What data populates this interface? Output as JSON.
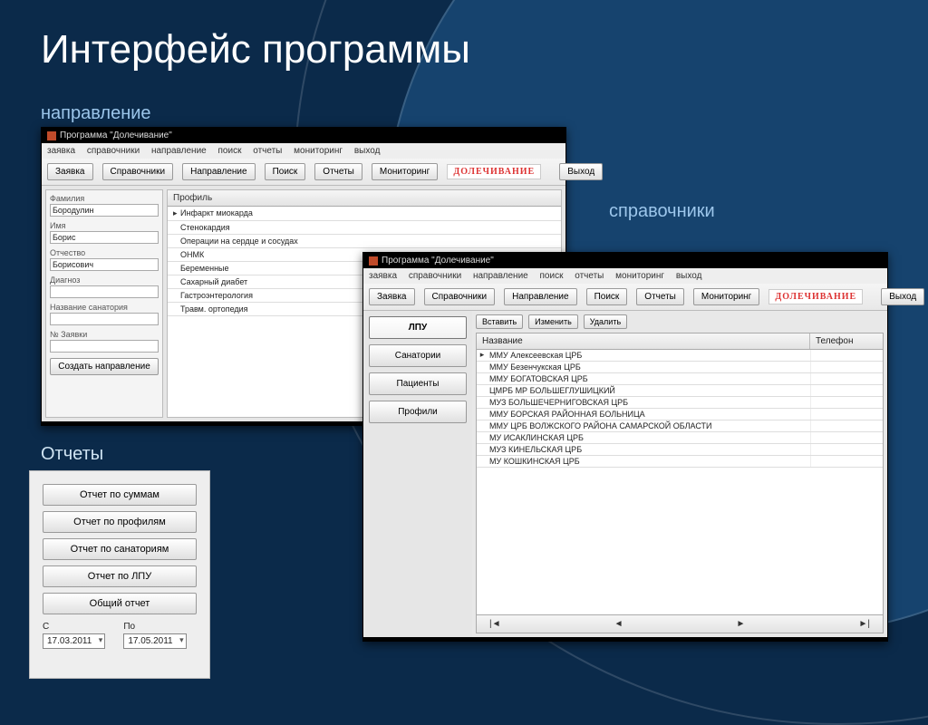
{
  "slide": {
    "title": "Интерфейс программы",
    "captions": {
      "napravlenie": "направление",
      "spravochniki": "справочники",
      "otchety": "Отчеты"
    }
  },
  "app": {
    "title": "Программа \"Долечивание\"",
    "menu": [
      "заявка",
      "справочники",
      "направление",
      "поиск",
      "отчеты",
      "мониторинг",
      "выход"
    ],
    "toolbar": [
      "Заявка",
      "Справочники",
      "Направление",
      "Поиск",
      "Отчеты",
      "Мониторинг"
    ],
    "badge": "ДОЛЕЧИВАНИЕ",
    "exit": "Выход"
  },
  "win1": {
    "form": {
      "familia_lbl": "Фамилия",
      "familia_val": "Бородулин",
      "imya_lbl": "Имя",
      "imya_val": "Борис",
      "otch_lbl": "Отчество",
      "otch_val": "Борисович",
      "diag_lbl": "Диагноз",
      "diag_val": "",
      "sanat_lbl": "Название санатория",
      "sanat_val": "",
      "zayav_lbl": "№ Заявки",
      "zayav_val": "",
      "create_btn": "Создать направление"
    },
    "grid_header": "Профиль",
    "grid_rows": [
      "Инфаркт миокарда",
      "Стенокардия",
      "Операции на сердце и сосудах",
      "ОНМК",
      "Беременные",
      "Сахарный диабет",
      "Гастроэнтерология",
      "Травм. ортопедия"
    ]
  },
  "win2": {
    "side": {
      "lpu": "ЛПУ",
      "sanat": "Санатории",
      "pac": "Пациенты",
      "prof": "Профили"
    },
    "crud": {
      "ins": "Вставить",
      "upd": "Изменить",
      "del": "Удалить"
    },
    "cols": {
      "name": "Название",
      "phone": "Телефон"
    },
    "rows": [
      "ММУ Алексеевская ЦРБ",
      "ММУ Безенчукская ЦРБ",
      "ММУ БОГАТОВСКАЯ ЦРБ",
      "ЦМРБ МР БОЛЬШЕГЛУШИЦКИЙ",
      "МУЗ БОЛЬШЕЧЕРНИГОВСКАЯ ЦРБ",
      "ММУ БОРСКАЯ РАЙОННАЯ БОЛЬНИЦА",
      "ММУ ЦРБ ВОЛЖСКОГО РАЙОНА САМАРСКОЙ ОБЛАСТИ",
      "МУ ИСАКЛИНСКАЯ ЦРБ",
      "МУЗ КИНЕЛЬСКАЯ ЦРБ",
      "МУ КОШКИНСКАЯ ЦРБ"
    ],
    "nav": {
      "first": "|◄",
      "prev": "◄",
      "next": "►",
      "last": "►|"
    }
  },
  "reports": {
    "btns": [
      "Отчет по суммам",
      "Отчет по профилям",
      "Отчет по санаториям",
      "Отчет по ЛПУ",
      "Общий отчет"
    ],
    "from_lbl": "С",
    "to_lbl": "По",
    "from_val": "17.03.2011",
    "to_val": "17.05.2011"
  }
}
